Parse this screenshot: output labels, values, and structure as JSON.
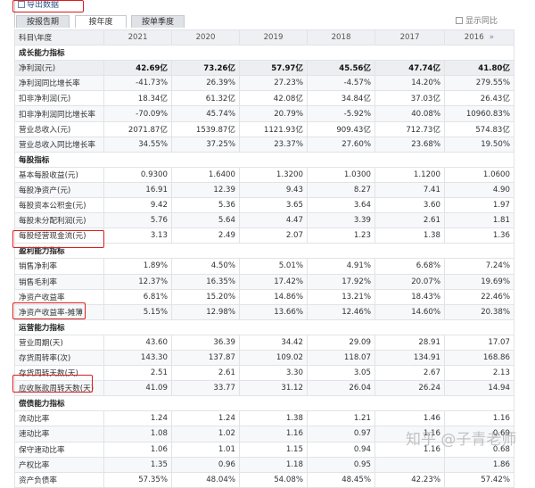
{
  "toolbar": {
    "export_label": "导出数据"
  },
  "tabs": [
    {
      "label": "按报告期",
      "active": false
    },
    {
      "label": "按年度",
      "active": true
    },
    {
      "label": "按单季度",
      "active": false
    }
  ],
  "compare_label": "显示同比",
  "header": {
    "label": "科目\\年度",
    "years": [
      "2021",
      "2020",
      "2019",
      "2018",
      "2017",
      "2016"
    ],
    "more": "»"
  },
  "sections": [
    {
      "title": "成长能力指标",
      "rows": [
        {
          "label": "净利润(元)",
          "values": [
            "42.69亿",
            "73.26亿",
            "57.97亿",
            "45.56亿",
            "47.74亿",
            "41.80亿"
          ],
          "highlight": true
        },
        {
          "label": "净利润同比增长率",
          "values": [
            "-41.73%",
            "26.39%",
            "27.23%",
            "-4.57%",
            "14.20%",
            "279.55%"
          ]
        },
        {
          "label": "扣非净利润(元)",
          "values": [
            "18.34亿",
            "61.32亿",
            "42.08亿",
            "34.84亿",
            "37.03亿",
            "26.43亿"
          ]
        },
        {
          "label": "扣非净利润同比增长率",
          "values": [
            "-70.09%",
            "45.74%",
            "20.79%",
            "-5.92%",
            "40.08%",
            "10960.83%"
          ]
        },
        {
          "label": "营业总收入(元)",
          "values": [
            "2071.87亿",
            "1539.87亿",
            "1121.93亿",
            "909.43亿",
            "712.73亿",
            "574.83亿"
          ]
        },
        {
          "label": "营业总收入同比增长率",
          "values": [
            "34.55%",
            "37.25%",
            "23.37%",
            "27.60%",
            "23.68%",
            "19.50%"
          ]
        }
      ]
    },
    {
      "title": "每股指标",
      "rows": [
        {
          "label": "基本每股收益(元)",
          "values": [
            "0.9300",
            "1.6400",
            "1.3200",
            "1.0300",
            "1.1200",
            "1.0600"
          ]
        },
        {
          "label": "每股净资产(元)",
          "values": [
            "16.91",
            "12.39",
            "9.43",
            "8.27",
            "7.41",
            "4.90"
          ]
        },
        {
          "label": "每股资本公积金(元)",
          "values": [
            "9.42",
            "5.36",
            "3.65",
            "3.64",
            "3.60",
            "1.97"
          ]
        },
        {
          "label": "每股未分配利润(元)",
          "values": [
            "5.76",
            "5.64",
            "4.47",
            "3.39",
            "2.61",
            "1.81"
          ]
        },
        {
          "label": "每股经营现金流(元)",
          "values": [
            "3.13",
            "2.49",
            "2.07",
            "1.23",
            "1.38",
            "1.36"
          ]
        }
      ]
    },
    {
      "title": "盈利能力指标",
      "rows": [
        {
          "label": "销售净利率",
          "values": [
            "1.89%",
            "4.50%",
            "5.01%",
            "4.91%",
            "6.68%",
            "7.24%"
          ]
        },
        {
          "label": "销售毛利率",
          "values": [
            "12.37%",
            "16.35%",
            "17.42%",
            "17.92%",
            "20.07%",
            "19.69%"
          ]
        },
        {
          "label": "净资产收益率",
          "values": [
            "6.81%",
            "15.20%",
            "14.86%",
            "13.21%",
            "18.43%",
            "22.46%"
          ]
        },
        {
          "label": "净资产收益率-摊薄",
          "values": [
            "5.15%",
            "12.98%",
            "13.66%",
            "12.46%",
            "14.60%",
            "20.38%"
          ]
        }
      ]
    },
    {
      "title": "运营能力指标",
      "rows": [
        {
          "label": "营业周期(天)",
          "values": [
            "43.60",
            "36.39",
            "34.42",
            "29.09",
            "28.91",
            "17.07"
          ]
        },
        {
          "label": "存货周转率(次)",
          "values": [
            "143.30",
            "137.87",
            "109.02",
            "118.07",
            "134.91",
            "168.86"
          ]
        },
        {
          "label": "存货周转天数(天)",
          "values": [
            "2.51",
            "2.61",
            "3.30",
            "3.05",
            "2.67",
            "2.13"
          ]
        },
        {
          "label": "应收账款周转天数(天)",
          "values": [
            "41.09",
            "33.77",
            "31.12",
            "26.04",
            "26.24",
            "14.94"
          ]
        }
      ]
    },
    {
      "title": "偿债能力指标",
      "rows": [
        {
          "label": "流动比率",
          "values": [
            "1.24",
            "1.24",
            "1.38",
            "1.21",
            "1.46",
            "1.16"
          ]
        },
        {
          "label": "速动比率",
          "values": [
            "1.08",
            "1.02",
            "1.16",
            "0.97",
            "1.16",
            "0.69"
          ]
        },
        {
          "label": "保守速动比率",
          "values": [
            "1.06",
            "1.01",
            "1.15",
            "0.94",
            "1.16",
            "0.68"
          ]
        },
        {
          "label": "产权比率",
          "values": [
            "1.35",
            "0.96",
            "1.18",
            "0.95",
            "",
            "1.86"
          ]
        },
        {
          "label": "资产负债率",
          "values": [
            "57.35%",
            "48.04%",
            "54.08%",
            "48.45%",
            "42.23%",
            "57.42%"
          ]
        }
      ]
    }
  ],
  "watermark": "知乎 @子青老师"
}
